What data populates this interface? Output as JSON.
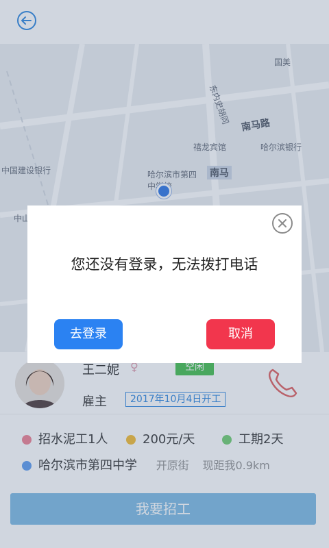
{
  "header": {
    "back_icon": "back-arrow-circle-icon"
  },
  "map": {
    "labels": [
      "国美",
      "南马路",
      "东内史胡同",
      "禧龙宾馆",
      "哈尔滨银行",
      "中国建设银行",
      "哈尔滨市第四中学校",
      "南马",
      "中山"
    ]
  },
  "employer": {
    "name": "王二妮",
    "gender_icon": "female-symbol-icon",
    "status": "空闲",
    "role": "雇主",
    "start_date": "2017年10月4日开工",
    "phone_icon": "phone-icon"
  },
  "job": {
    "recruit": "招水泥工1人",
    "wage": "200元/天",
    "duration": "工期2天",
    "location": "哈尔滨市第四中学",
    "street": "开原街",
    "distance": "现距我0.9km",
    "dot_colors": {
      "recruit": "#f08a9a",
      "wage": "#f5c040",
      "duration": "#7ad17a",
      "location": "#6aa3f0"
    }
  },
  "actions": {
    "hire_button": "我要招工"
  },
  "dialog": {
    "message": "您还没有登录，无法拨打电话",
    "login_button": "去登录",
    "cancel_button": "取消",
    "login_color": "#2b82f2",
    "cancel_color": "#f2364d"
  }
}
